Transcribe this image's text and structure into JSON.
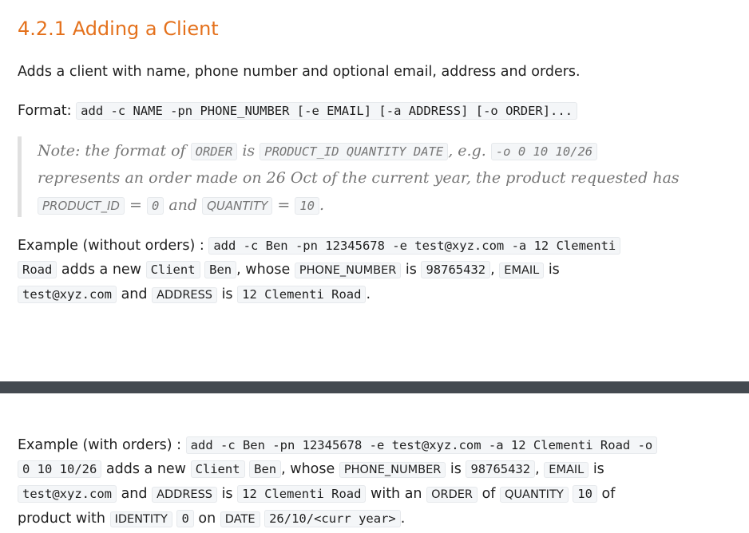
{
  "heading": "4.2.1 Adding a Client",
  "intro": "Adds a client with name, phone number and optional email, address and orders.",
  "format": {
    "label": "Format:",
    "command": "add -c NAME -pn PHONE_NUMBER [-e EMAIL] [-a ADDRESS] [-o ORDER]..."
  },
  "note": {
    "t1": "Note: the format of",
    "c1": "ORDER",
    "t2": "is",
    "c2": "PRODUCT_ID QUANTITY DATE",
    "t3": ", e.g.",
    "c3": "-o 0 10 10/26",
    "line2": "represents an order made on 26 Oct of the current year, the product requested has",
    "c4": "PRODUCT_ID",
    "t4": "=",
    "c5": "0",
    "t5": "and",
    "c6": "QUANTITY",
    "t6": "=",
    "c7": "10",
    "t7": "."
  },
  "example1": {
    "label": "Example (without orders) :",
    "cmd_a": "add -c Ben -pn 12345678 -e test@xyz.com -a 12 Clementi",
    "cmd_b": "Road",
    "t1": "adds a new",
    "c1": "Client",
    "c2": "Ben",
    "t2": ", whose",
    "c3": "PHONE_NUMBER",
    "t3": "is",
    "c4": "98765432",
    "t4": ",",
    "c5": "EMAIL",
    "t5": "is",
    "c6": "test@xyz.com",
    "t6": "and",
    "c7": "ADDRESS",
    "t7": "is",
    "c8": "12 Clementi Road",
    "t8": "."
  },
  "example2": {
    "label": "Example (with orders) :",
    "cmd_a": "add -c Ben -pn 12345678 -e test@xyz.com -a 12 Clementi Road -o",
    "cmd_b": "0 10 10/26",
    "t1": "adds a new",
    "c1": "Client",
    "c2": "Ben",
    "t2": ", whose",
    "c3": "PHONE_NUMBER",
    "t3": "is",
    "c4": "98765432",
    "t4": ",",
    "c5": "EMAIL",
    "t5": "is",
    "c6": "test@xyz.com",
    "t6": "and",
    "c7": "ADDRESS",
    "t7": "is",
    "c8": "12 Clementi Road",
    "t8": "with an",
    "c9": "ORDER",
    "t9": "of",
    "c10": "QUANTITY",
    "c11": "10",
    "t10": "of",
    "t11": "product with",
    "c12": "IDENTITY",
    "c13": "0",
    "t12": "on",
    "c14": "DATE",
    "c15": "26/10/<curr year>",
    "t13": "."
  },
  "colors": {
    "heading": "#e4711c",
    "separator": "#444a50",
    "code_bg": "#f4f6f8",
    "note_text": "#767676"
  }
}
